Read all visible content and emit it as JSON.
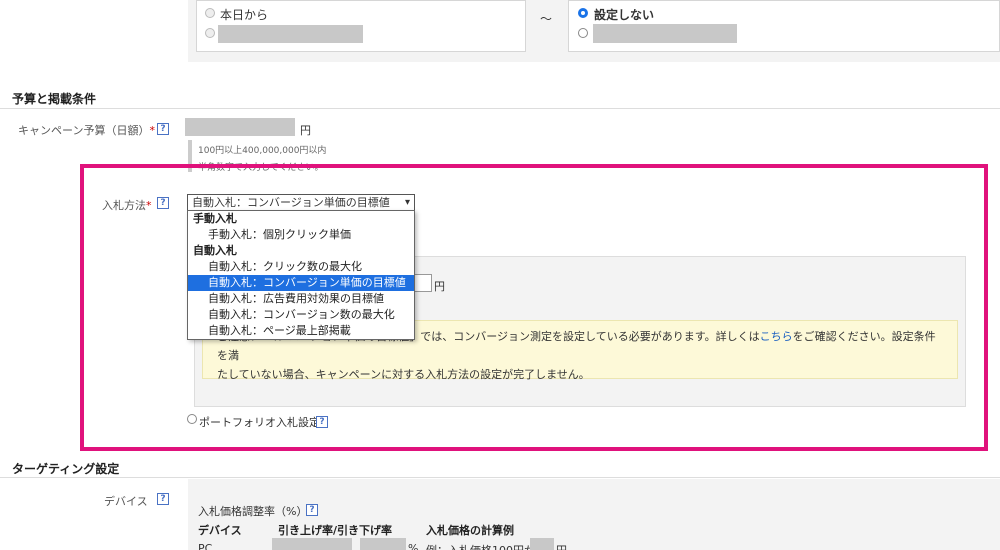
{
  "schedule": {
    "start_option_label": "本日から",
    "tilde": "〜",
    "end_option_label": "設定しない"
  },
  "budget_section": {
    "title": "予算と掲載条件",
    "daily_budget_label": "キャンペーン予算（日額）",
    "required_mark": "*",
    "help_mark": "?",
    "yen": "円",
    "hint_line1": "100円以上400,000,000円以内",
    "hint_line2": "半角数字で入力してください。"
  },
  "bidding": {
    "label": "入札方法",
    "required_mark": "*",
    "help_mark": "?",
    "selected_value": "自動入札：コンバージョン単価の目標値",
    "dropdown": [
      {
        "text": "手動入札",
        "group": true
      },
      {
        "text": "手動入札：個別クリック単価",
        "group": false
      },
      {
        "text": "自動入札",
        "group": true
      },
      {
        "text": "自動入札：クリック数の最大化",
        "group": false
      },
      {
        "text": "自動入札：コンバージョン単価の目標値",
        "group": false,
        "selected": true
      },
      {
        "text": "自動入札：広告費用対効果の目標値",
        "group": false
      },
      {
        "text": "自動入札：コンバージョン数の最大化",
        "group": false
      },
      {
        "text": "自動入札：ページ最上部掲載",
        "group": false
      }
    ],
    "target_yen": "円",
    "note_prefix": "ご注意：「コンバージョン単価の目標値」では、コンバージョン測定を設定している必要があります。詳しくは",
    "note_link": "こちら",
    "note_suffix": "をご確認ください。設定条件を満",
    "note_line2": "たしていない場合、キャンペーンに対する入札方法の設定が完了しません。",
    "portfolio_label": "ポートフォリオ入札設定",
    "portfolio_help": "?"
  },
  "targeting": {
    "title": "ターゲティング設定",
    "device_label": "デバイス",
    "device_help": "?",
    "adjust_label": "入札価格調整率（%）",
    "adjust_help": "?",
    "columns": [
      "デバイス",
      "引き上げ率/引き下げ率",
      "入札価格の計算例"
    ],
    "row_device": "PC",
    "row_percent": "%",
    "row_example": "例：入札価格100円か",
    "row_yen": "円"
  },
  "colors": {
    "highlight": "#e0127c",
    "selected_option": "#1e6fe0",
    "link": "#1a5fc0"
  }
}
